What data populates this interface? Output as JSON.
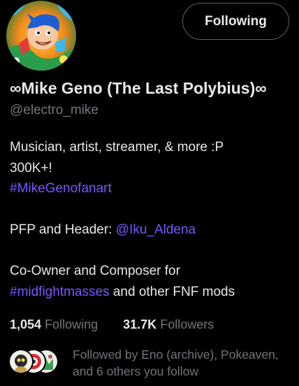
{
  "profile": {
    "display_name": "∞Mike Geno (The Last Polybius)∞",
    "handle": "@electro_mike",
    "follow_button_label": "Following",
    "avatar_icon": "cartoon-portrait-avatar"
  },
  "bio": {
    "line1": "Musician, artist, streamer, & more :P",
    "line2": "300K+!",
    "hashtag1": "#MikeGenofanart",
    "pfp_prefix": "PFP and Header: ",
    "pfp_mention": "@Iku_Aldena",
    "co_owner_line": "Co-Owner and Composer for",
    "hashtag2": "#midfightmasses",
    "mods_suffix": " and other FNF mods"
  },
  "stats": {
    "following_count": "1,054",
    "following_label": "Following",
    "followers_count": "31.7K",
    "followers_label": "Followers"
  },
  "followed_by": {
    "text": "Followed by Eno (archive), Pokeaven, and 6 others you follow",
    "avatar_icons": [
      "follower-avatar-eno",
      "follower-avatar-pokeaven",
      "follower-avatar-other"
    ]
  },
  "colors": {
    "background": "#000000",
    "text_primary": "#e7e9ea",
    "text_secondary": "#71767b",
    "link": "#7856ff",
    "button_border": "#536471"
  }
}
